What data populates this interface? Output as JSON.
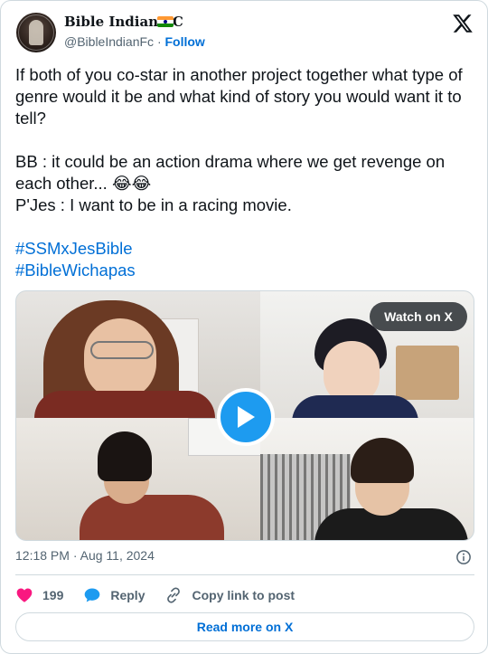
{
  "author": {
    "display_name": "Bible Indian FC",
    "handle": "@BibleIndianFc",
    "separator": "·",
    "follow_label": "Follow",
    "flag_icon": "india-flag-icon"
  },
  "tweet": {
    "line1": "If both of you co-star in another project together what type of genre would it be and what kind of story you would want it to tell?",
    "line2": "BB : it could be an action drama where we get revenge on each other... 😂😂",
    "line3": "P'Jes : I want to be in a racing movie.",
    "hashtags": [
      "#SSMxJesBible",
      "#BibleWichapas"
    ]
  },
  "media": {
    "watch_label": "Watch on X"
  },
  "meta": {
    "time": "12:18 PM",
    "dot": "·",
    "date": "Aug 11, 2024"
  },
  "actions": {
    "likes_count": "199",
    "reply_label": "Reply",
    "copy_label": "Copy link to post"
  },
  "read_more_label": "Read more on X",
  "colors": {
    "link": "#006fd6",
    "like": "#f91880",
    "reply": "#1d9bf0",
    "play": "#1d9bf0"
  }
}
